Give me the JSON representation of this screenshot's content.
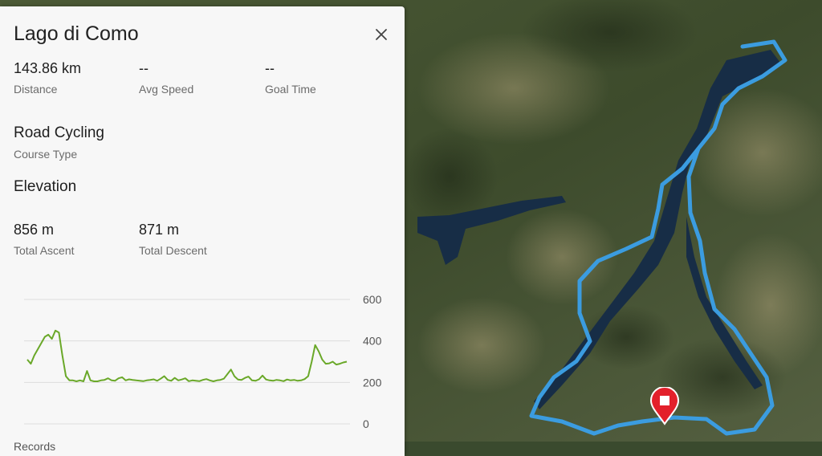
{
  "course": {
    "title": "Lago di Como",
    "stats_row1": [
      {
        "value": "143.86 km",
        "label": "Distance"
      },
      {
        "value": "--",
        "label": "Avg Speed"
      },
      {
        "value": "--",
        "label": "Goal Time"
      }
    ],
    "course_type": {
      "value": "Road Cycling",
      "label": "Course Type"
    },
    "elevation_heading": "Elevation",
    "stats_row2": [
      {
        "value": "856 m",
        "label": "Total Ascent"
      },
      {
        "value": "871 m",
        "label": "Total Descent"
      }
    ],
    "partial_label": "Records"
  },
  "chart_data": {
    "type": "line",
    "title": "",
    "xlabel": "",
    "ylabel": "",
    "ylim": [
      0,
      600
    ],
    "yticks": [
      600,
      400,
      200,
      0
    ],
    "grid": true,
    "series": [
      {
        "color": "#6aa829",
        "values": [
          310,
          290,
          330,
          360,
          390,
          420,
          430,
          410,
          450,
          440,
          330,
          230,
          210,
          210,
          205,
          210,
          205,
          255,
          210,
          205,
          205,
          210,
          212,
          220,
          210,
          208,
          220,
          225,
          210,
          215,
          212,
          210,
          208,
          206,
          210,
          212,
          215,
          208,
          218,
          230,
          212,
          208,
          222,
          210,
          214,
          220,
          206,
          210,
          208,
          206,
          212,
          216,
          210,
          205,
          210,
          212,
          218,
          240,
          262,
          230,
          214,
          212,
          222,
          228,
          210,
          208,
          215,
          233,
          214,
          210,
          208,
          212,
          210,
          206,
          214,
          210,
          212,
          208,
          210,
          216,
          230,
          300,
          380,
          350,
          310,
          290,
          292,
          300,
          286,
          290,
          296,
          300
        ]
      }
    ]
  },
  "map": {
    "route_color": "#3b9ce0",
    "water_color": "#172d46",
    "marker_color": "#e3202b"
  }
}
